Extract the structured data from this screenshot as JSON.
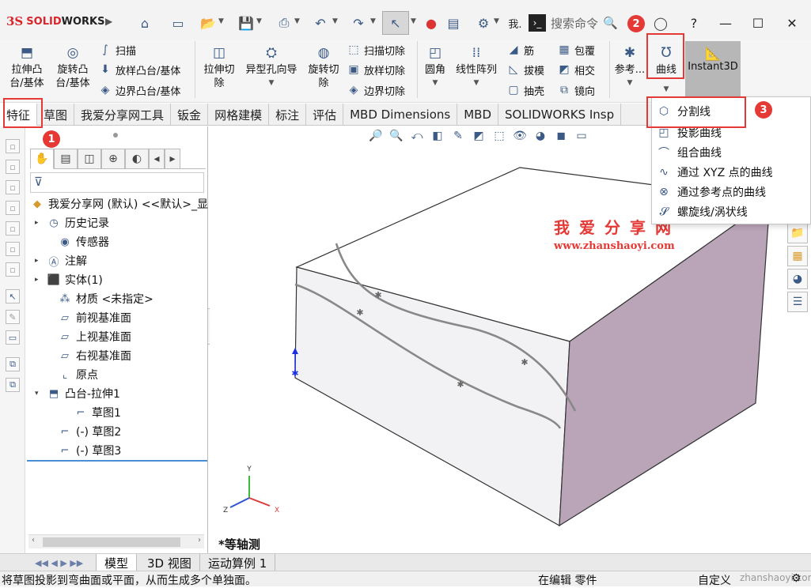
{
  "app": {
    "brand_prefix": "3S",
    "brand_solid": "SOLID",
    "brand_works": "WORKS"
  },
  "titlebar": {
    "search_placeholder": "搜索命令",
    "truncated_label": "我.",
    "window_buttons": [
      "minimize",
      "maximize",
      "close"
    ]
  },
  "badges": [
    "1",
    "2",
    "3"
  ],
  "ribbon": {
    "extrude_boss": "拉伸凸\n台/基体",
    "revolve_boss": "旋转凸\n台/基体",
    "sweep": "扫描",
    "loft_boss": "放样凸台/基体",
    "boundary_boss": "边界凸台/基体",
    "extrude_cut": "拉伸切\n除",
    "hole_wizard": "异型孔向导",
    "revolve_cut": "旋转切\n除",
    "sweep_cut": "扫描切除",
    "loft_cut": "放样切除",
    "boundary_cut": "边界切除",
    "fillet": "圆角",
    "linear_pattern": "线性阵列",
    "rib": "筋",
    "draft": "拔模",
    "shell": "抽壳",
    "wrap": "包覆",
    "intersect": "相交",
    "mirror": "镜向",
    "reference": "参考...",
    "curves": "曲线",
    "instant3d": "Instant3D"
  },
  "tabs": [
    "特征",
    "草图",
    "我爱分享网工具",
    "钣金",
    "网格建模",
    "标注",
    "评估",
    "MBD Dimensions",
    "MBD",
    "SOLIDWORKS Insp"
  ],
  "feature_tree": {
    "root": "我爱分享网 (默认) <<默认>_显",
    "items": [
      {
        "label": "历史记录",
        "expand": "▸",
        "icon": "history-icon"
      },
      {
        "label": "传感器",
        "expand": "",
        "icon": "sensor-icon"
      },
      {
        "label": "注解",
        "expand": "▸",
        "icon": "annotation-icon"
      },
      {
        "label": "实体(1)",
        "expand": "▸",
        "icon": "solid-body-icon"
      },
      {
        "label": "材质 <未指定>",
        "expand": "",
        "icon": "material-icon"
      },
      {
        "label": "前视基准面",
        "expand": "",
        "icon": "plane-icon"
      },
      {
        "label": "上视基准面",
        "expand": "",
        "icon": "plane-icon"
      },
      {
        "label": "右视基准面",
        "expand": "",
        "icon": "plane-icon"
      },
      {
        "label": "原点",
        "expand": "",
        "icon": "origin-icon"
      },
      {
        "label": "凸台-拉伸1",
        "expand": "▾",
        "icon": "extrude-icon"
      },
      {
        "label": "草图1",
        "expand": "",
        "icon": "sketch-icon"
      },
      {
        "label": "(-) 草图2",
        "expand": "",
        "icon": "sketch-icon"
      },
      {
        "label": "(-) 草图3",
        "expand": "",
        "icon": "sketch-icon"
      }
    ]
  },
  "curves_menu": [
    "分割线",
    "投影曲线",
    "组合曲线",
    "通过 XYZ 点的曲线",
    "通过参考点的曲线",
    "螺旋线/涡状线"
  ],
  "watermark": {
    "title": "我爱分享网",
    "url": "www.zhanshaoyi.com",
    "corner": "zhanshaoyi.com"
  },
  "view": {
    "orientation": "*等轴测",
    "axes": [
      "Y",
      "X",
      "Z"
    ]
  },
  "bottom_tabs": [
    "模型",
    "3D 视图",
    "运动算例 1"
  ],
  "status": {
    "message": "将草图投影到弯曲面或平面，从而生成多个单独面。",
    "mode": "在编辑 零件",
    "units": "自定义"
  },
  "colors": {
    "accent_red": "#e53935",
    "side_face": "#b9a4b8",
    "brand_red": "#d8262c"
  }
}
